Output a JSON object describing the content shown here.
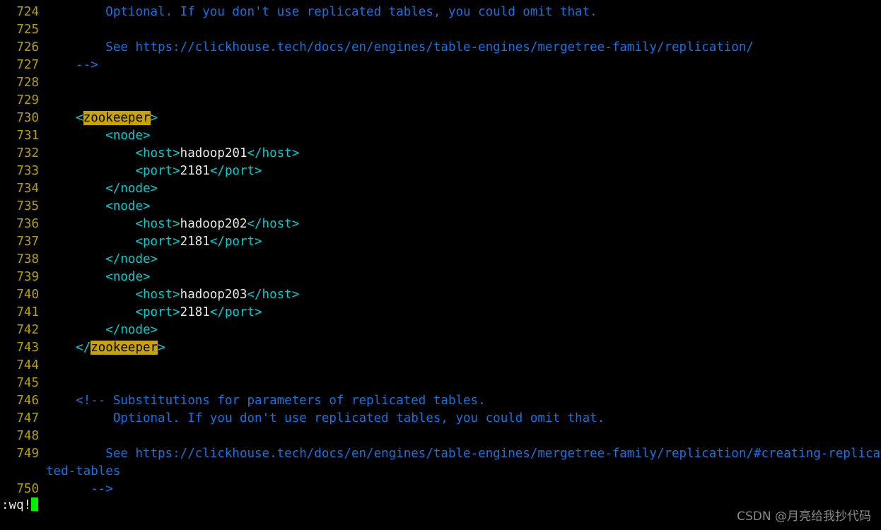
{
  "app": {
    "kind": "terminal-vim-editor",
    "background_color": "#000000",
    "filetype": "xml"
  },
  "colors": {
    "background": "#000000",
    "line_number": "#b5a000",
    "comment": "#1672e0",
    "tag": "#00cdcd",
    "text": "#e8e8e8",
    "search_highlight_bg": "#c9a300",
    "search_highlight_fg": "#000000",
    "cursor": "#00f000",
    "watermark": "#8a8a8a"
  },
  "editor": {
    "first_line_number": 724,
    "last_line_number": 750,
    "search_term": "zookeeper",
    "lines": [
      {
        "number": "724",
        "segments": [
          {
            "text": "        Optional. If you don't use replicated tables, you could omit that.",
            "style": "comment"
          }
        ]
      },
      {
        "number": "725",
        "segments": []
      },
      {
        "number": "726",
        "segments": [
          {
            "text": "        See https://clickhouse.tech/docs/en/engines/table-engines/mergetree-family/replication/",
            "style": "comment"
          }
        ]
      },
      {
        "number": "727",
        "segments": [
          {
            "text": "    -->",
            "style": "comment"
          }
        ]
      },
      {
        "number": "728",
        "segments": []
      },
      {
        "number": "729",
        "segments": []
      },
      {
        "number": "730",
        "segments": [
          {
            "text": "    <",
            "style": "tag"
          },
          {
            "text": "zookeeper",
            "style": "highlight"
          },
          {
            "text": ">",
            "style": "tag"
          }
        ]
      },
      {
        "number": "731",
        "segments": [
          {
            "text": "        <node>",
            "style": "tag"
          }
        ]
      },
      {
        "number": "732",
        "segments": [
          {
            "text": "            <host>",
            "style": "tag"
          },
          {
            "text": "hadoop201",
            "style": "text"
          },
          {
            "text": "</host>",
            "style": "tag"
          }
        ]
      },
      {
        "number": "733",
        "segments": [
          {
            "text": "            <port>",
            "style": "tag"
          },
          {
            "text": "2181",
            "style": "text"
          },
          {
            "text": "</port>",
            "style": "tag"
          }
        ]
      },
      {
        "number": "734",
        "segments": [
          {
            "text": "        </node>",
            "style": "tag"
          }
        ]
      },
      {
        "number": "735",
        "segments": [
          {
            "text": "        <node>",
            "style": "tag"
          }
        ]
      },
      {
        "number": "736",
        "segments": [
          {
            "text": "            <host>",
            "style": "tag"
          },
          {
            "text": "hadoop202",
            "style": "text"
          },
          {
            "text": "</host>",
            "style": "tag"
          }
        ]
      },
      {
        "number": "737",
        "segments": [
          {
            "text": "            <port>",
            "style": "tag"
          },
          {
            "text": "2181",
            "style": "text"
          },
          {
            "text": "</port>",
            "style": "tag"
          }
        ]
      },
      {
        "number": "738",
        "segments": [
          {
            "text": "        </node>",
            "style": "tag"
          }
        ]
      },
      {
        "number": "739",
        "segments": [
          {
            "text": "        <node>",
            "style": "tag"
          }
        ]
      },
      {
        "number": "740",
        "segments": [
          {
            "text": "            <host>",
            "style": "tag"
          },
          {
            "text": "hadoop203",
            "style": "text"
          },
          {
            "text": "</host>",
            "style": "tag"
          }
        ]
      },
      {
        "number": "741",
        "segments": [
          {
            "text": "            <port>",
            "style": "tag"
          },
          {
            "text": "2181",
            "style": "text"
          },
          {
            "text": "</port>",
            "style": "tag"
          }
        ]
      },
      {
        "number": "742",
        "segments": [
          {
            "text": "        </node>",
            "style": "tag"
          }
        ]
      },
      {
        "number": "743",
        "segments": [
          {
            "text": "    </",
            "style": "tag"
          },
          {
            "text": "zookeeper",
            "style": "highlight"
          },
          {
            "text": ">",
            "style": "tag"
          }
        ]
      },
      {
        "number": "744",
        "segments": []
      },
      {
        "number": "745",
        "segments": []
      },
      {
        "number": "746",
        "segments": [
          {
            "text": "    <!-- Substitutions for parameters of replicated tables.",
            "style": "comment"
          }
        ]
      },
      {
        "number": "747",
        "segments": [
          {
            "text": "         Optional. If you don't use replicated tables, you could omit that.",
            "style": "comment"
          }
        ]
      },
      {
        "number": "748",
        "segments": []
      },
      {
        "number": "749",
        "wrapped": true,
        "segments": [
          {
            "text": "        See https://clickhouse.tech/docs/en/engines/table-engines/mergetree-family/replication/#creating-replicated-tables",
            "style": "comment"
          }
        ]
      },
      {
        "number": "750",
        "segments": [
          {
            "text": "      -->",
            "style": "comment"
          }
        ]
      }
    ]
  },
  "command_line": {
    "text": ":wq!",
    "cursor_visible": true
  },
  "watermark": {
    "text": "CSDN @月亮给我抄代码"
  }
}
